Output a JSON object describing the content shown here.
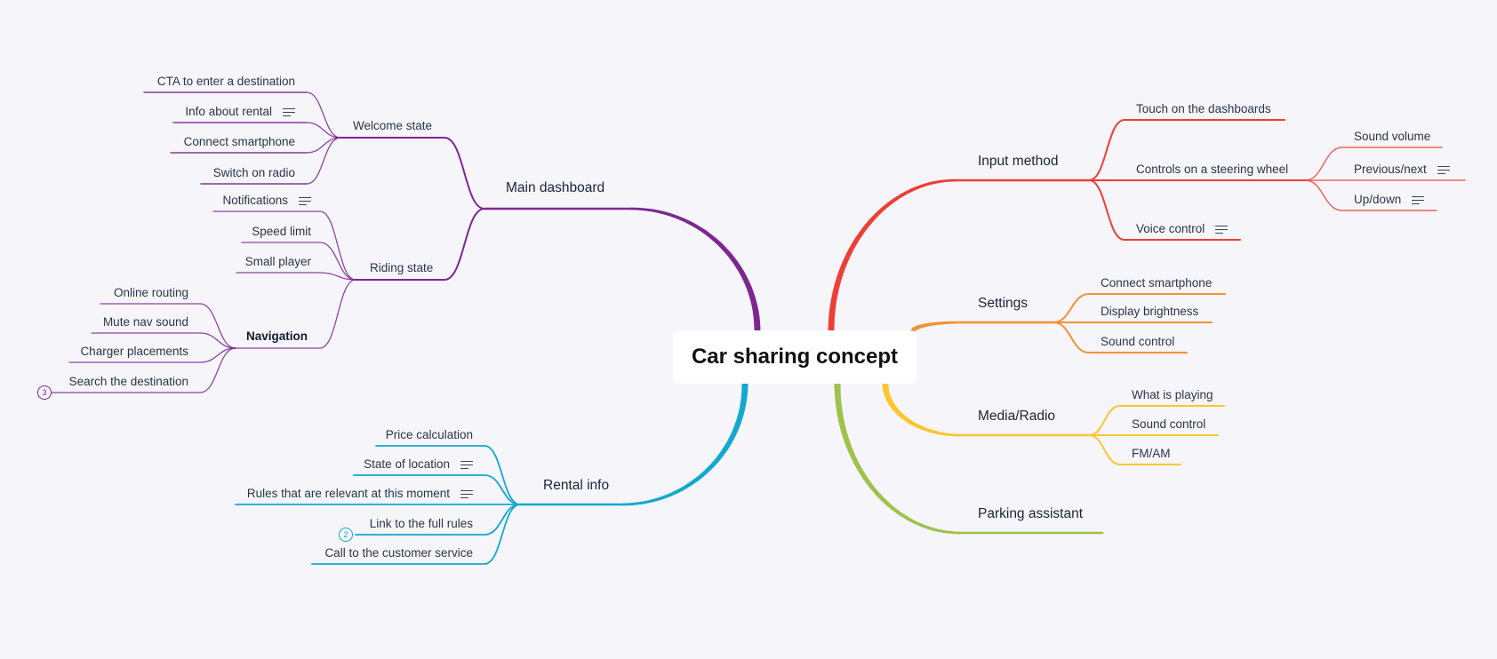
{
  "root": {
    "label": "Car sharing concept"
  },
  "branches": {
    "main_dashboard": {
      "label": "Main dashboard",
      "color": "#7d2690",
      "children": {
        "welcome_state": {
          "label": "Welcome state",
          "items": [
            {
              "label": "CTA to enter a destination",
              "note": false
            },
            {
              "label": "Info about rental",
              "note": true
            },
            {
              "label": "Connect smartphone",
              "note": false
            },
            {
              "label": "Switch on radio",
              "note": false
            }
          ]
        },
        "riding_state": {
          "label": "Riding state",
          "items": [
            {
              "label": "Notifications",
              "note": true
            },
            {
              "label": "Speed limit",
              "note": false
            },
            {
              "label": "Small player",
              "note": false
            }
          ]
        },
        "navigation": {
          "label": "Navigation",
          "items": [
            {
              "label": "Online routing"
            },
            {
              "label": "Mute nav sound"
            },
            {
              "label": "Charger placements"
            },
            {
              "label": "Search the destination",
              "badge": "3"
            }
          ]
        }
      }
    },
    "rental_info": {
      "label": "Rental info",
      "color": "#12a8cf",
      "items": [
        {
          "label": "Price calculation",
          "note": false
        },
        {
          "label": "State of location",
          "note": true
        },
        {
          "label": "Rules that are relevant at this moment",
          "note": true
        },
        {
          "label": "Link to the full rules",
          "badge": "2"
        },
        {
          "label": "Call to the customer service",
          "note": false
        }
      ]
    },
    "input_method": {
      "label": "Input method",
      "color": "#ee3e35",
      "items": [
        {
          "label": "Touch on the dashboards"
        },
        {
          "label": "Controls on a steering wheel",
          "items": [
            {
              "label": "Sound volume",
              "note": false
            },
            {
              "label": "Previous/next",
              "note": true
            },
            {
              "label": "Up/down",
              "note": true
            }
          ]
        },
        {
          "label": "Voice control",
          "note": true
        }
      ]
    },
    "settings": {
      "label": "Settings",
      "color": "#f59132",
      "items": [
        {
          "label": "Connect smartphone"
        },
        {
          "label": "Display brightness"
        },
        {
          "label": "Sound control"
        }
      ]
    },
    "media_radio": {
      "label": "Media/Radio",
      "color": "#fcc630",
      "items": [
        {
          "label": "What is playing"
        },
        {
          "label": "Sound control"
        },
        {
          "label": "FM/AM"
        }
      ]
    },
    "parking_assistant": {
      "label": "Parking assistant",
      "color": "#9ec24a"
    }
  },
  "icons": {
    "note": "note-lines-icon",
    "badge": "numbered-badge-icon"
  }
}
